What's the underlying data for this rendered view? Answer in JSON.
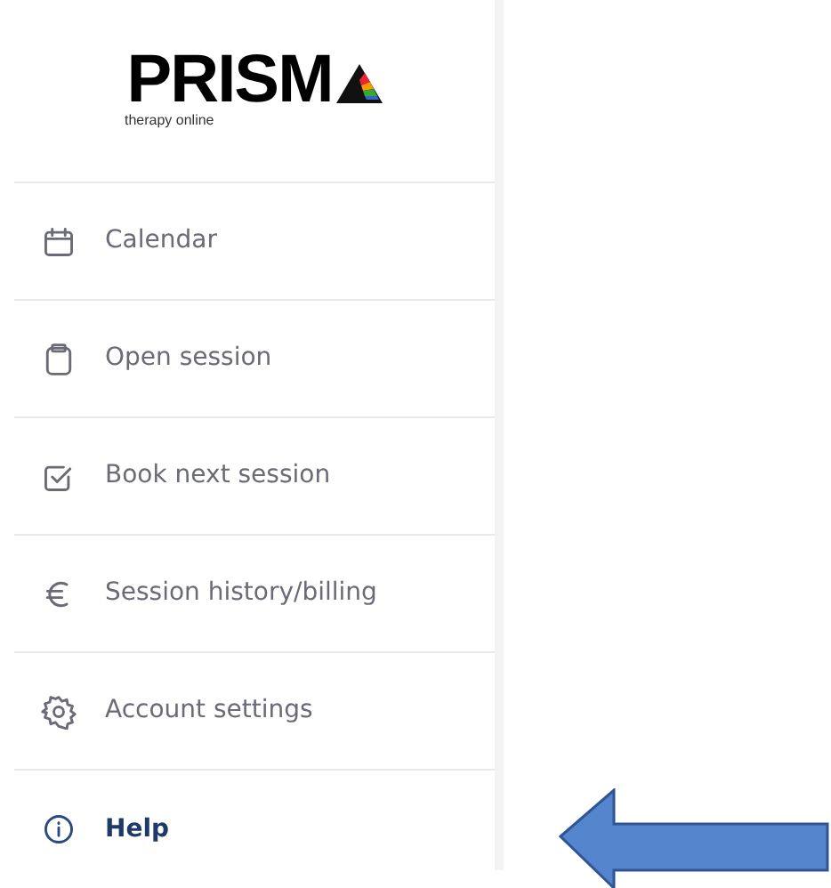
{
  "logo": {
    "name": "PRISM",
    "tagline": "therapy online"
  },
  "menu": [
    {
      "label": "Calendar",
      "selected": false
    },
    {
      "label": "Open session",
      "selected": false
    },
    {
      "label": "Book next session",
      "selected": false
    },
    {
      "label": "Session history/billing",
      "selected": false
    },
    {
      "label": "Account settings",
      "selected": false
    },
    {
      "label": "Help",
      "selected": true
    }
  ]
}
